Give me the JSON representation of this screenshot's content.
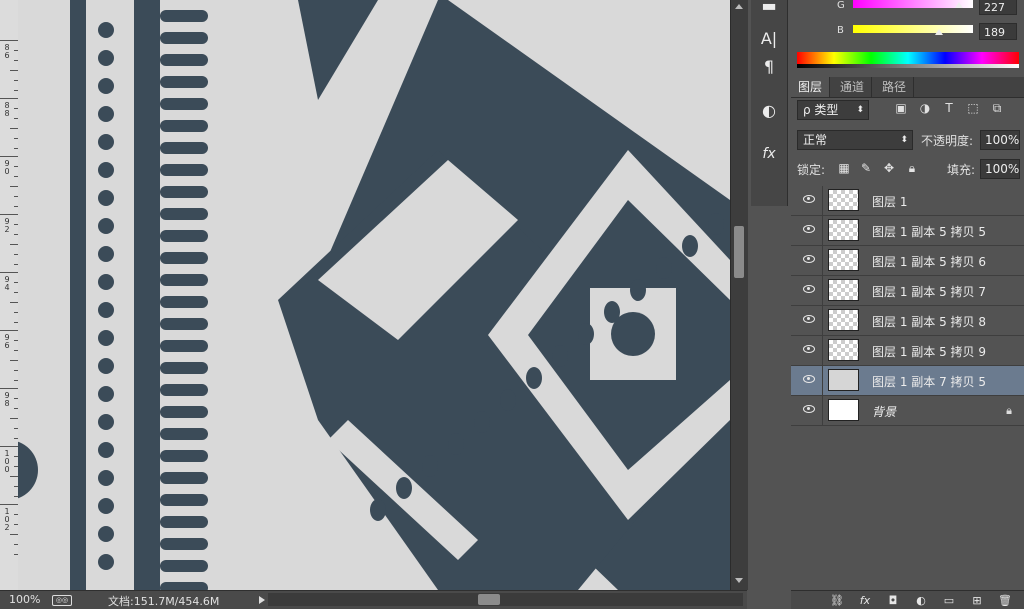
{
  "ruler": {
    "labels": [
      "86",
      "88",
      "90",
      "92",
      "94",
      "96",
      "98",
      "100",
      "102"
    ]
  },
  "status": {
    "zoom": "100%",
    "doc": "文档:151.7M/454.6M"
  },
  "tools": [
    {
      "icon": "text-icon",
      "glyph": "A|"
    },
    {
      "icon": "paragraph-icon",
      "glyph": "¶"
    },
    {
      "icon": "color-wheel-icon",
      "glyph": "◐"
    },
    {
      "icon": "fx-icon",
      "glyph": "fx"
    }
  ],
  "color": {
    "g_label": "G",
    "g_value": "227",
    "b_label": "B",
    "b_value": "189",
    "g_color": "#ff00ff",
    "b_color": "#ffff00"
  },
  "tabs": [
    "图层",
    "通道",
    "路径"
  ],
  "filter": {
    "kind": "ρ 类型",
    "icons": [
      "image-filter-icon",
      "adjustment-filter-icon",
      "type-filter-icon",
      "shape-filter-icon",
      "smart-object-filter-icon"
    ]
  },
  "blend": {
    "mode": "正常",
    "opacity_label": "不透明度:",
    "opacity_value": "100%"
  },
  "lockrow": {
    "label": "锁定:",
    "fill_label": "填充:",
    "fill_value": "100%"
  },
  "layers": [
    {
      "name": "图层 1",
      "selected": false,
      "thumb": "checker"
    },
    {
      "name": "图层 1 副本 5 拷贝 5",
      "selected": false,
      "thumb": "checker"
    },
    {
      "name": "图层 1 副本 5 拷贝 6",
      "selected": false,
      "thumb": "checker"
    },
    {
      "name": "图层 1 副本 5 拷贝 7",
      "selected": false,
      "thumb": "checker"
    },
    {
      "name": "图层 1 副本 5 拷贝 8",
      "selected": false,
      "thumb": "checker"
    },
    {
      "name": "图层 1 副本 5 拷贝 9",
      "selected": false,
      "thumb": "checker"
    },
    {
      "name": "图层 1 副本 7 拷贝 5",
      "selected": true,
      "thumb": "grey"
    },
    {
      "name": "背景",
      "selected": false,
      "thumb": "plain",
      "locked": true
    }
  ],
  "footer_icons": [
    "link-icon",
    "fx-icon",
    "mask-icon",
    "adjustment-icon",
    "group-folder-icon",
    "new-layer-icon",
    "trash-icon"
  ],
  "colors": {
    "pattern": "#3b4b58",
    "canvas_bg": "#d9d9d9",
    "selected_layer": "#6b7b8f"
  }
}
